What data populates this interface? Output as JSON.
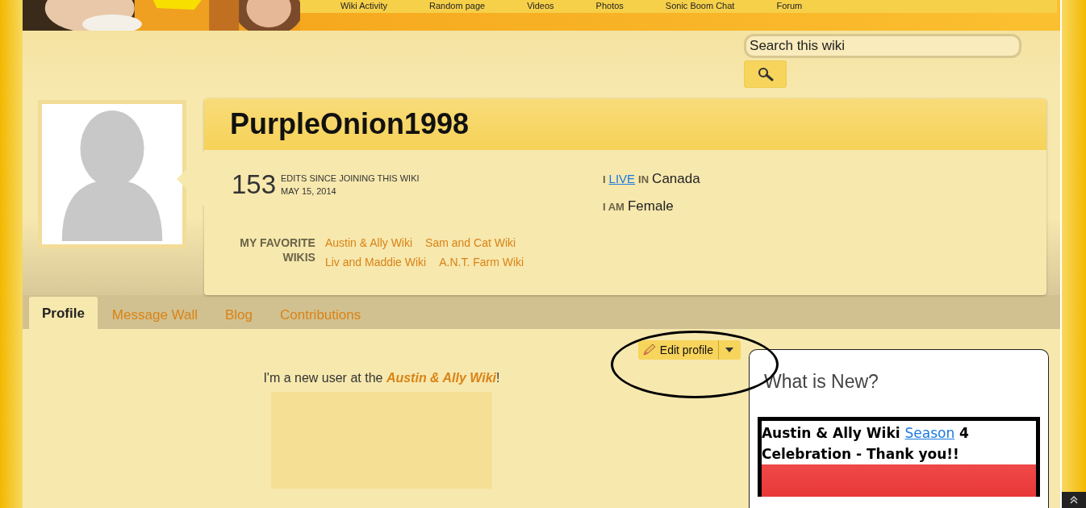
{
  "nav": {
    "items": [
      "Wiki Activity",
      "Random page",
      "Videos",
      "Photos",
      "Sonic Boom Chat",
      "Forum"
    ]
  },
  "search": {
    "placeholder": "Search this wiki"
  },
  "profile": {
    "username": "PurpleOnion1998",
    "edit_count": "153",
    "edits_label": "EDITS SINCE JOINING THIS WIKI",
    "joined": "MAY 15, 2014",
    "facts": [
      {
        "prefix": "I",
        "link": "LIVE",
        "suffix": "IN",
        "value": "Canada"
      },
      {
        "prefix": "I AM",
        "value": "Female"
      }
    ],
    "favorites_label": "MY FAVORITE WIKIS",
    "favorites": [
      "Austin & Ally Wiki",
      "Sam and Cat Wiki",
      "Liv and Maddie Wiki",
      "A.N.T. Farm Wiki"
    ]
  },
  "tabs": [
    {
      "label": "Profile",
      "selected": true
    },
    {
      "label": "Message Wall",
      "selected": false
    },
    {
      "label": "Blog",
      "selected": false
    },
    {
      "label": "Contributions",
      "selected": false
    }
  ],
  "edit_button": {
    "label": "Edit profile"
  },
  "intro": "I'm a new user at the **Austin & Ally Wiki**!",
  "sidebar": {
    "title": "What is New?",
    "news_title": "Austin & Ally Wiki",
    "news_link": "Season",
    "news_rest": "4 Celebration - Thank you!!"
  }
}
